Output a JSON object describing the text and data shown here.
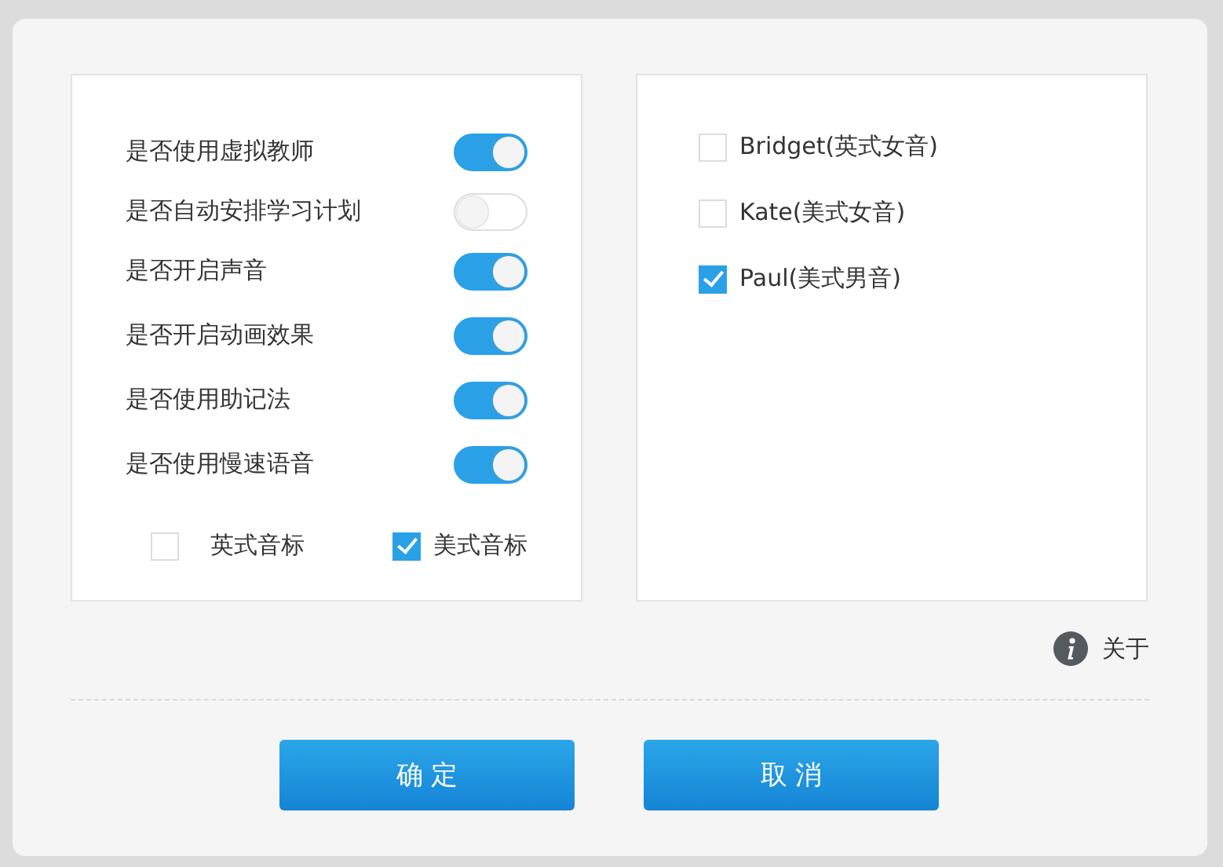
{
  "settings": [
    {
      "label": "是否使用虚拟教师",
      "on": true
    },
    {
      "label": "是否自动安排学习计划",
      "on": false
    },
    {
      "label": "是否开启声音",
      "on": true
    },
    {
      "label": "是否开启动画效果",
      "on": true
    },
    {
      "label": "是否使用助记法",
      "on": true
    },
    {
      "label": "是否使用慢速语音",
      "on": true
    }
  ],
  "phonetics": [
    {
      "label": "英式音标",
      "checked": false
    },
    {
      "label": "美式音标",
      "checked": true
    }
  ],
  "voices": [
    {
      "label": "Bridget(英式女音)",
      "checked": false
    },
    {
      "label": "Kate(美式女音)",
      "checked": false
    },
    {
      "label": "Paul(美式男音)",
      "checked": true
    }
  ],
  "about": "关于",
  "buttons": [
    "确 定",
    "取 消"
  ]
}
